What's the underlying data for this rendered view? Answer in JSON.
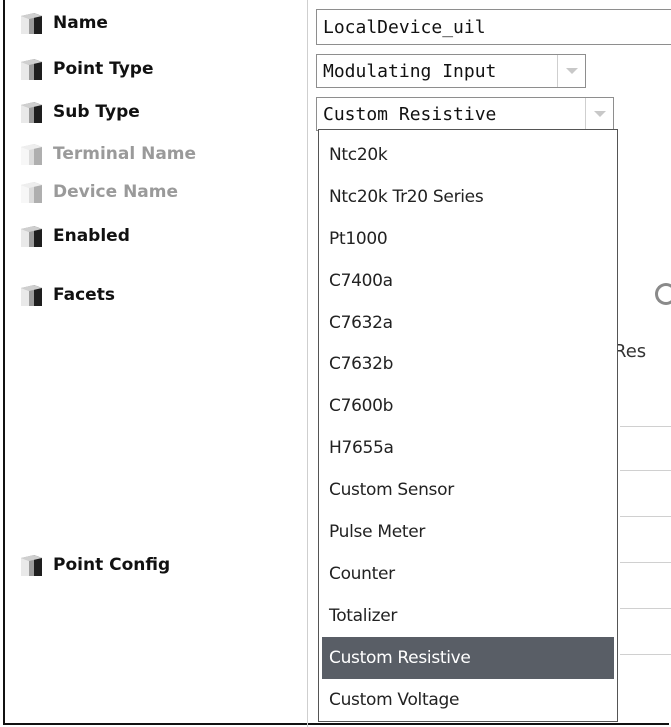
{
  "properties": [
    {
      "label": "Name",
      "enabled": true
    },
    {
      "label": "Point Type",
      "enabled": true
    },
    {
      "label": "Sub Type",
      "enabled": true
    },
    {
      "label": "Terminal Name",
      "enabled": false
    },
    {
      "label": "Device Name",
      "enabled": false
    },
    {
      "label": "Enabled",
      "enabled": true
    },
    {
      "label": "Facets",
      "enabled": true
    },
    {
      "label": "Point Config",
      "enabled": true
    }
  ],
  "fields": {
    "name_value": "LocalDevice_uil",
    "point_type_value": "Modulating Input",
    "sub_type_value": "Custom Resistive"
  },
  "dropdown": {
    "items": [
      "Ntc20k",
      "Ntc20k Tr20 Series",
      "Pt1000",
      "C7400a",
      "C7632a",
      "C7632b",
      "C7600b",
      "H7655a",
      "Custom Sensor",
      "Pulse Meter",
      "Counter",
      "Totalizer",
      "Custom Resistive",
      "Custom Voltage"
    ],
    "selected_index": 12
  },
  "background": {
    "partial_text": "Res"
  },
  "icons": {
    "property_icon": "cube-slot-icon",
    "dropdown_arrow": "chevron-down-icon",
    "busy_indicator": "spinner-icon"
  },
  "colors": {
    "selection_bg": "#595e66",
    "disabled_text": "#9a9a9a"
  }
}
